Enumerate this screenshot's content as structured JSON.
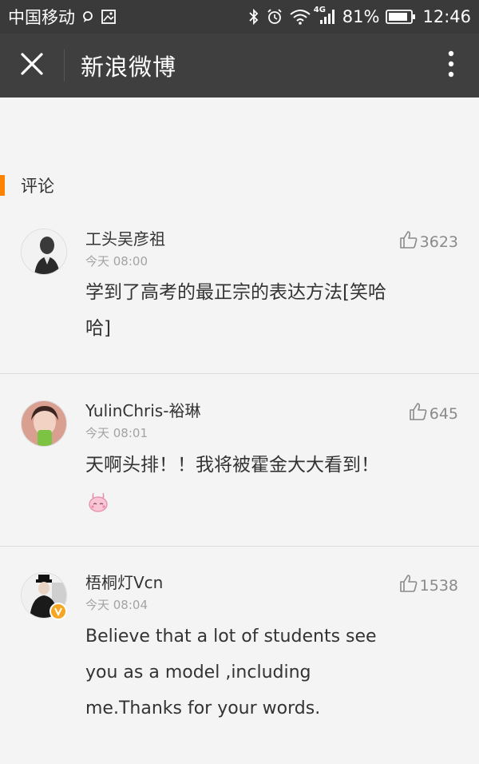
{
  "status_bar": {
    "carrier": "中国移动",
    "network": "4G",
    "battery": "81%",
    "time": "12:46"
  },
  "nav": {
    "title": "新浪微博"
  },
  "section": {
    "title": "评论"
  },
  "comments": [
    {
      "username": "工头吴彦祖",
      "time": "今天 08:00",
      "likes": "3623",
      "text": "学到了高考的最正宗的表达方法[笑哈哈]"
    },
    {
      "username": "YulinChris-裕琳",
      "time": "今天 08:01",
      "likes": "645",
      "text": "天啊头排！！我将被霍金大大看到！"
    },
    {
      "username": "梧桐灯Vcn",
      "time": "今天 08:04",
      "likes": "1538",
      "text": "Believe that a lot of students see you as a model ,including me.Thanks for your words."
    }
  ],
  "colors": {
    "accent": "#ff8200",
    "nav_bg": "#3f3f3f",
    "status_bg": "#3a3a3a",
    "verified": "#f5a623"
  }
}
